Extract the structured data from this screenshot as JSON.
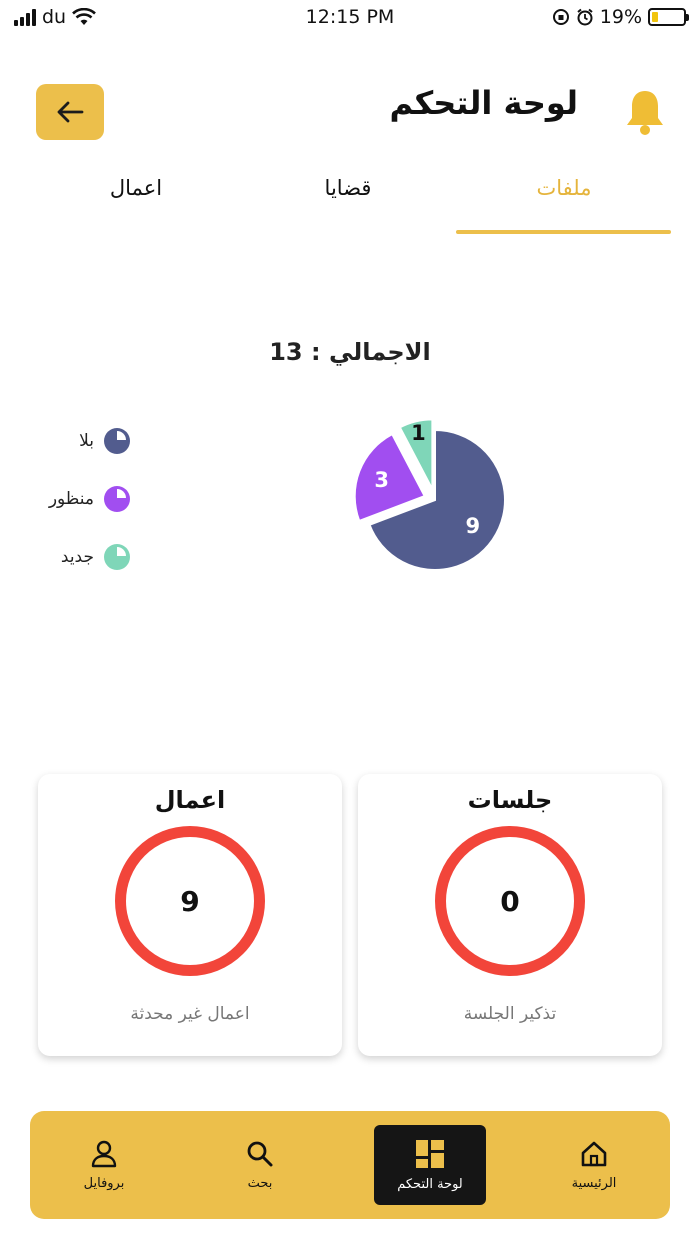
{
  "status": {
    "carrier": "du",
    "time": "12:15 PM",
    "battery": "19%",
    "battery_level": 0.19
  },
  "header": {
    "title": "لوحة التحكم",
    "back_icon": "arrow-left-icon",
    "bell_icon": "bell-icon"
  },
  "tabs": [
    {
      "label": "ملفات",
      "active": true
    },
    {
      "label": "قضايا",
      "active": false
    },
    {
      "label": "اعمال",
      "active": false
    }
  ],
  "total": {
    "label": "الاجمالي :",
    "value": "13"
  },
  "legend": [
    {
      "label": "بلا",
      "color": "#525c8e"
    },
    {
      "label": "منظور",
      "color": "#a14ef0"
    },
    {
      "label": "جديد",
      "color": "#7fd6b8"
    }
  ],
  "chart_data": {
    "type": "pie",
    "slices": [
      {
        "label": "بلا",
        "value": 9,
        "color": "#525c8e"
      },
      {
        "label": "منظور",
        "value": 3,
        "color": "#a14ef0"
      },
      {
        "label": "جديد",
        "value": 1,
        "color": "#7fd6b8"
      }
    ],
    "total": 13
  },
  "cards": {
    "sessions": {
      "title": "جلسات",
      "value": "0",
      "subtitle": "تذكير الجلسة"
    },
    "works": {
      "title": "اعمال",
      "value": "9",
      "subtitle": "اعمال غير محدثة"
    }
  },
  "nav": [
    {
      "label": "الرئيسية",
      "icon": "home-icon",
      "active": false
    },
    {
      "label": "لوحة التحكم",
      "icon": "dashboard-icon",
      "active": true
    },
    {
      "label": "بحث",
      "icon": "search-icon",
      "active": false
    },
    {
      "label": "بروفايل",
      "icon": "user-icon",
      "active": false
    }
  ],
  "colors": {
    "accent": "#ecbf4b",
    "ring": "#f2453a"
  }
}
